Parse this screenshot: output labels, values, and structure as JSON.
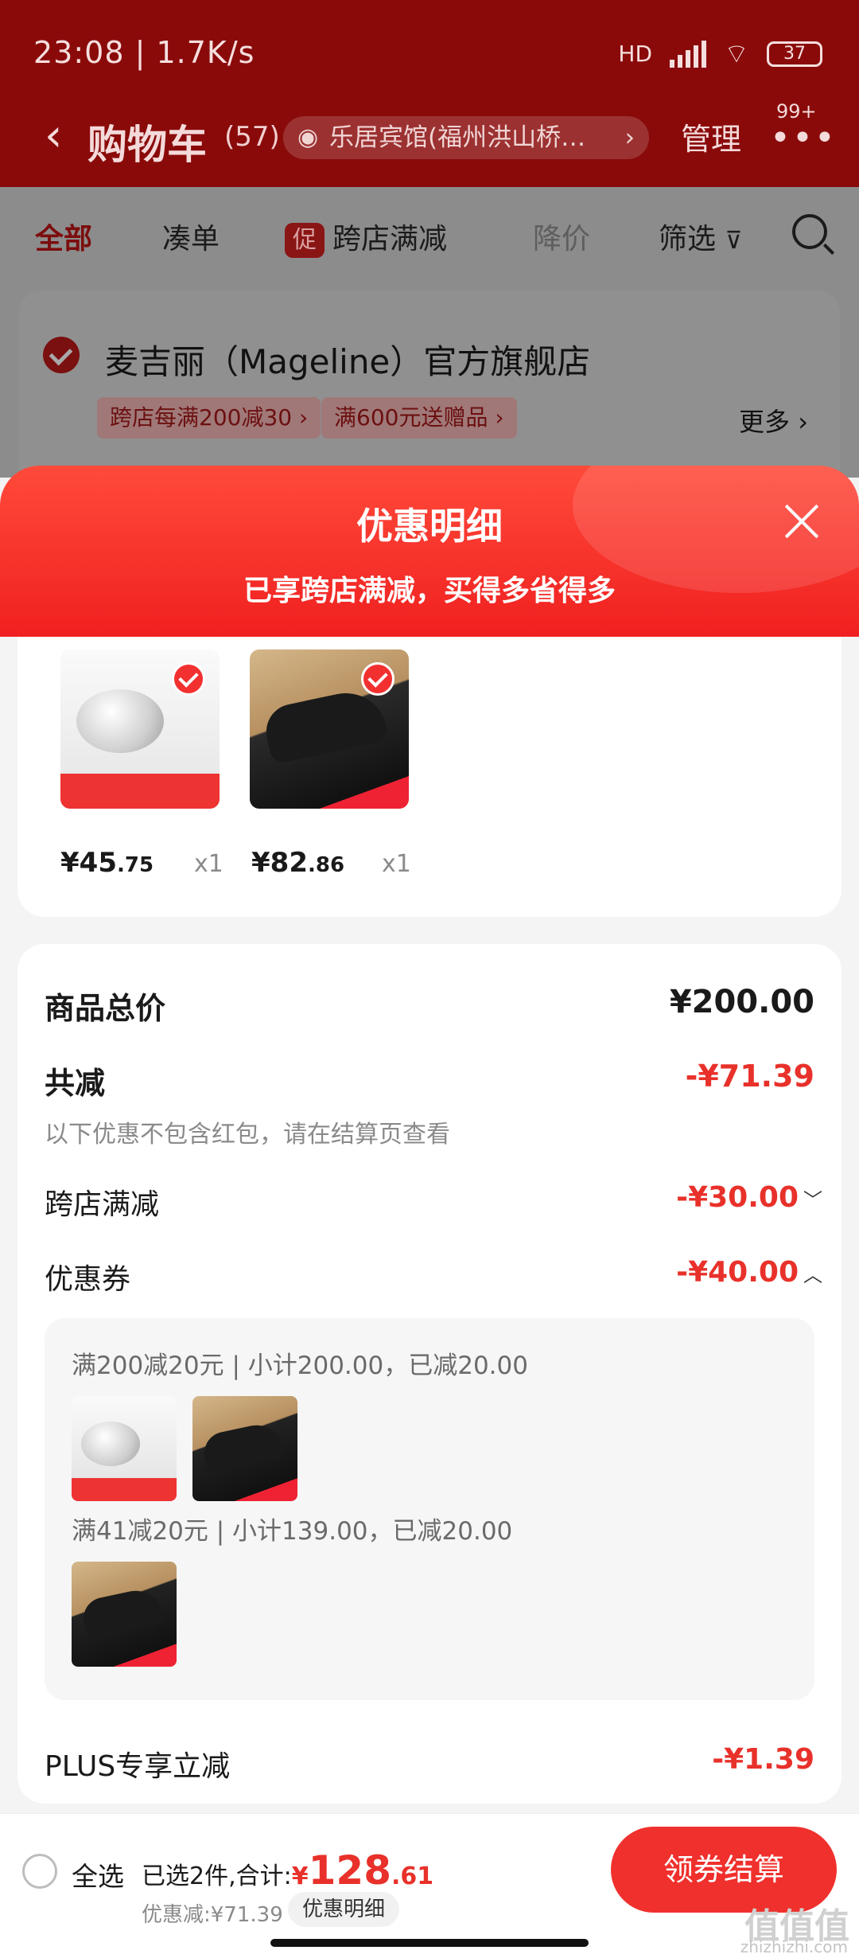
{
  "status_bar": {
    "time_speed": "23:08 | 1.7K/s",
    "network": "HD",
    "battery": "37"
  },
  "nav": {
    "back_icon": "‹",
    "title": "购物车",
    "count": "(57)",
    "location": "乐居宾馆(福州洪山桥…",
    "manage": "管理",
    "more_badge": "99+"
  },
  "tabs": [
    {
      "label": "全部"
    },
    {
      "label": "凑单"
    },
    {
      "tag": "促",
      "label": "跨店满减"
    },
    {
      "label": "降价"
    },
    {
      "label": "筛选"
    }
  ],
  "store": {
    "name": "麦吉丽（Mageline）官方旗舰店",
    "tags": [
      "跨店每满200减30 ›",
      "满600元送赠品 ›"
    ],
    "more": "更多 ›"
  },
  "modal": {
    "title": "优惠明细",
    "subtitle": "已享跨店满减，买得多省得多",
    "products": [
      {
        "price_main": "¥45",
        "price_decimal": ".75",
        "qty": "x1"
      },
      {
        "price_main": "¥82",
        "price_decimal": ".86",
        "qty": "x1"
      }
    ],
    "summary": {
      "total_label": "商品总价",
      "total_value": "¥200.00",
      "reduce_label": "共减",
      "reduce_value": "-¥71.39",
      "note": "以下优惠不包含红包，请在结算页查看",
      "cross_label": "跨店满减",
      "cross_value": "-¥30.00",
      "coupon_label": "优惠券",
      "coupon_value": "-¥40.00",
      "coupon_lines": [
        "满200减20元 | 小计200.00，已减20.00",
        "满41减20元 | 小计139.00，已减20.00"
      ],
      "plus_label": "PLUS专享立减",
      "plus_value": "-¥1.39"
    }
  },
  "bottom": {
    "select_all": "全选",
    "selected": "已选2件,合计:",
    "currency": "¥",
    "total_main": "128",
    "total_decimal": ".61",
    "discount": "优惠减:¥71.39",
    "detail": "优惠明细",
    "checkout": "领券结算"
  },
  "watermark": {
    "text": "值值值",
    "sub": "zhizhizhi.com"
  }
}
